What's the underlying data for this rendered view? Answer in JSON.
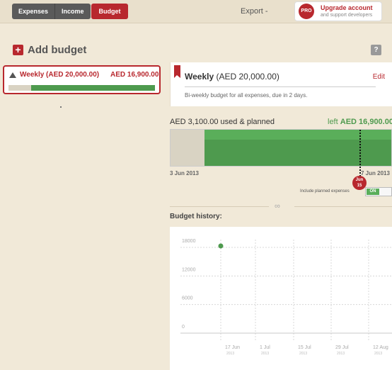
{
  "topbar": {
    "tabs": [
      {
        "label": "Expenses"
      },
      {
        "label": "Income"
      }
    ],
    "budget_tab": "Budget",
    "export": "Export -",
    "upgrade": {
      "seal": "PRO",
      "title": "Upgrade account",
      "subtitle": "and support developers"
    }
  },
  "sidebar": {
    "add_label": "Add budget",
    "help": "?",
    "budget_item": {
      "title": "Weekly (AED 20,000.00)",
      "amount": "AED 16,900.00",
      "progress_used": 0.155
    }
  },
  "detail": {
    "title": "Weekly",
    "title_amount": "(AED 20,000.00)",
    "edit": "Edit",
    "description": "Bi-weekly budget for all expenses, due in 2 days.",
    "used_label": "AED 3,100.00 used & planned",
    "left_prefix": "left",
    "left_amount": "AED 16,900.00",
    "progress_used": 0.155,
    "start_date": "3 Jun 2013",
    "end_date": "7 Jun 2013",
    "today_marker": {
      "month": "Jun",
      "day": "15"
    },
    "include_label": "Include planned expenses",
    "toggle": "ON",
    "link_icon": "link-icon"
  },
  "history": {
    "title": "Budget history:"
  },
  "chart_data": {
    "type": "scatter",
    "title": "Budget history:",
    "xlabel": "",
    "ylabel": "",
    "y_ticks": [
      "18000",
      "12000",
      "6000",
      "0"
    ],
    "ylim": [
      0,
      18000
    ],
    "x_ticks": [
      {
        "day": "17 Jun",
        "year": "2013"
      },
      {
        "day": "1 Jul",
        "year": "2013"
      },
      {
        "day": "15 Jul",
        "year": "2013"
      },
      {
        "day": "29 Jul",
        "year": "2013"
      },
      {
        "day": "12 Aug",
        "year": "2013"
      }
    ],
    "points": [
      {
        "x": "2013-06-17",
        "y": 18000
      }
    ],
    "grid": true,
    "colors": {
      "point": "#4e9a4e",
      "grid": "#d8d8d8"
    }
  }
}
